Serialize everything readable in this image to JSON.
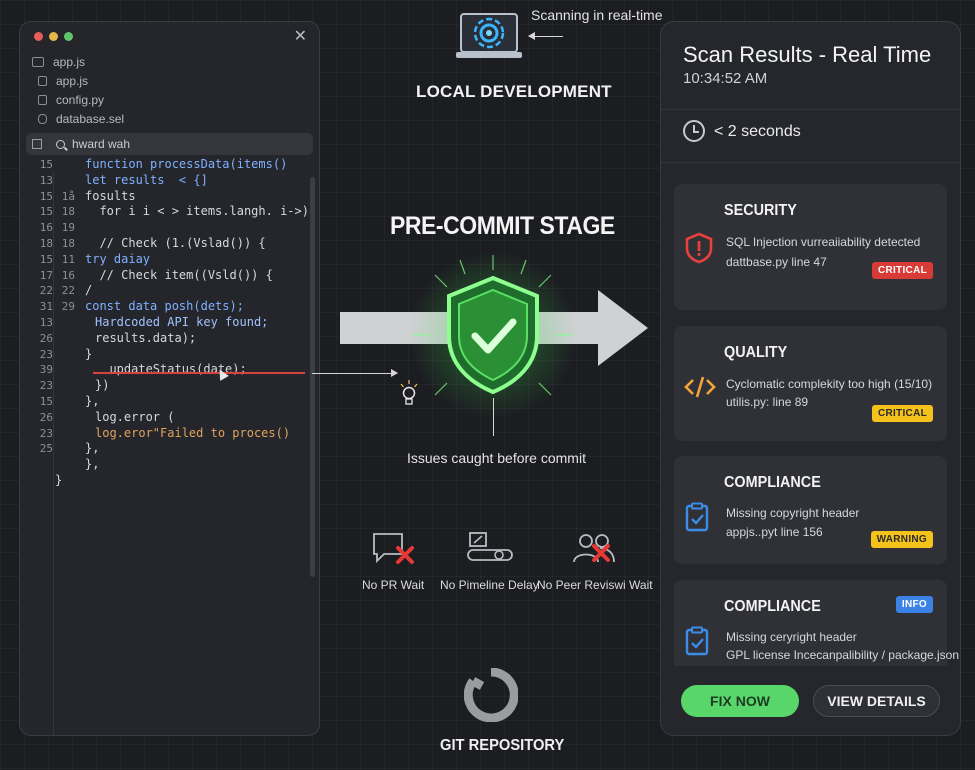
{
  "editor": {
    "files": [
      "app.js",
      "app.js",
      "config.py",
      "database.sel"
    ],
    "search_text": "hward wah",
    "lines": [
      {
        "n1": "15",
        "n2": "",
        "code": "function processData(items()",
        "indent": 0
      },
      {
        "n1": "13",
        "n2": "",
        "code": "let results  < {]",
        "indent": 0
      },
      {
        "n1": "15",
        "n2": "1å",
        "code": "fosults",
        "indent": 0
      },
      {
        "n1": "15",
        "n2": "18",
        "code": "  for i i < > items.langh. i->)",
        "indent": 0
      },
      {
        "n1": "16",
        "n2": "19",
        "code": "",
        "indent": 0
      },
      {
        "n1": "18",
        "n2": "18",
        "code": "  // Check (1.(Vslad()) {",
        "indent": 0
      },
      {
        "n1": "15",
        "n2": "11",
        "code": "try daiay",
        "indent": 0
      },
      {
        "n1": "17",
        "n2": "16",
        "code": "  // Check item((Vsld()) {",
        "indent": 0
      },
      {
        "n1": "22",
        "n2": "22",
        "code": "/",
        "indent": 0
      },
      {
        "n1": "31",
        "n2": "29",
        "code": "const data posh(dets);",
        "indent": 0
      },
      {
        "n1": "13",
        "n2": "",
        "code": "Hardcoded API key found;",
        "indent": 1
      },
      {
        "n1": "26",
        "n2": "",
        "code": "results.data);",
        "indent": 1
      },
      {
        "n1": "23",
        "n2": "",
        "code": "}",
        "indent": 0
      },
      {
        "n1": "39",
        "n2": "",
        "code": "  updateStatus(date);",
        "indent": 1
      },
      {
        "n1": "23",
        "n2": "",
        "code": "})",
        "indent": 1
      },
      {
        "n1": "15",
        "n2": "",
        "code": "},",
        "indent": 0
      },
      {
        "n1": "26",
        "n2": "",
        "code": "log.error (",
        "indent": 1
      },
      {
        "n1": "23",
        "n2": "",
        "code": "log.eror\"Failed to proces()",
        "indent": 1
      },
      {
        "n1": "25",
        "n2": "",
        "code": "},",
        "indent": 0
      },
      {
        "n1": "",
        "n2": "",
        "code": "},",
        "indent": 0
      },
      {
        "n1": "",
        "n2": "",
        "code": "}",
        "indent": -1
      }
    ]
  },
  "middle": {
    "scan_label": "Scanning in real-time",
    "local_dev": "LOCAL DEVELOPMENT",
    "stage_title": "PRE-COMMIT STAGE",
    "caught": "Issues caught before commit",
    "benefits": [
      "No PR Wait",
      "No Pimeline Delay",
      "No Peer Reviswi Wait"
    ],
    "git_label": "GIT REPOSITORY"
  },
  "panel": {
    "title": "Scan Results - Real Time",
    "time": "10:34:52 AM",
    "duration": "< 2 seconds",
    "cards": [
      {
        "title": "SECURITY",
        "line1": "SQL Injection vurreaiiability detected",
        "line2": "dattbase.py line 47",
        "badge": "CRITICAL",
        "icon": "shield-alert-icon"
      },
      {
        "title": "QUALITY",
        "line1": "Cyclomatic complekity too high (15/10)",
        "line2": "utilis.py: line 89",
        "badge": "CRITICAL",
        "icon": "code-icon"
      },
      {
        "title": "COMPLIANCE",
        "line1": "Missing copyright header",
        "line2": "appjs..pyt line 156",
        "badge": "WARNING",
        "icon": "clipboard-check-icon"
      },
      {
        "title": "COMPLIANCE",
        "line1": "Missing ceryright header",
        "line2": "GPL license Incecanpalibility / package.json",
        "badge": "INFO",
        "icon": "clipboard-check-icon"
      }
    ],
    "fix_label": "FIX NOW",
    "view_label": "VIEW DETAILS"
  },
  "colors": {
    "accent_green": "#58d66a",
    "critical_red": "#d83a36",
    "warning_yellow": "#f4c21a",
    "info_blue": "#3a82e6"
  }
}
